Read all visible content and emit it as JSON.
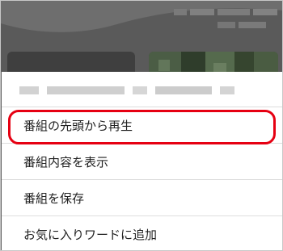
{
  "sheet": {
    "items": [
      {
        "label": "番組の先頭から再生"
      },
      {
        "label": "番組内容を表示"
      },
      {
        "label": "番組を保存"
      },
      {
        "label": "お気に入りワードに追加"
      }
    ]
  },
  "colors": {
    "highlight": "#e60012",
    "dim_overlay": "#5a5a5a",
    "divider": "#dddddd",
    "text": "#222222"
  }
}
